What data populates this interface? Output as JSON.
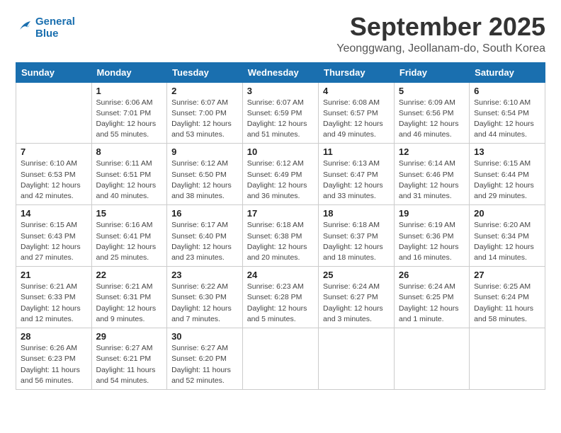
{
  "logo": {
    "line1": "General",
    "line2": "Blue"
  },
  "title": "September 2025",
  "subtitle": "Yeonggwang, Jeollanam-do, South Korea",
  "days_of_week": [
    "Sunday",
    "Monday",
    "Tuesday",
    "Wednesday",
    "Thursday",
    "Friday",
    "Saturday"
  ],
  "weeks": [
    [
      {
        "day": "",
        "detail": ""
      },
      {
        "day": "1",
        "detail": "Sunrise: 6:06 AM\nSunset: 7:01 PM\nDaylight: 12 hours\nand 55 minutes."
      },
      {
        "day": "2",
        "detail": "Sunrise: 6:07 AM\nSunset: 7:00 PM\nDaylight: 12 hours\nand 53 minutes."
      },
      {
        "day": "3",
        "detail": "Sunrise: 6:07 AM\nSunset: 6:59 PM\nDaylight: 12 hours\nand 51 minutes."
      },
      {
        "day": "4",
        "detail": "Sunrise: 6:08 AM\nSunset: 6:57 PM\nDaylight: 12 hours\nand 49 minutes."
      },
      {
        "day": "5",
        "detail": "Sunrise: 6:09 AM\nSunset: 6:56 PM\nDaylight: 12 hours\nand 46 minutes."
      },
      {
        "day": "6",
        "detail": "Sunrise: 6:10 AM\nSunset: 6:54 PM\nDaylight: 12 hours\nand 44 minutes."
      }
    ],
    [
      {
        "day": "7",
        "detail": "Sunrise: 6:10 AM\nSunset: 6:53 PM\nDaylight: 12 hours\nand 42 minutes."
      },
      {
        "day": "8",
        "detail": "Sunrise: 6:11 AM\nSunset: 6:51 PM\nDaylight: 12 hours\nand 40 minutes."
      },
      {
        "day": "9",
        "detail": "Sunrise: 6:12 AM\nSunset: 6:50 PM\nDaylight: 12 hours\nand 38 minutes."
      },
      {
        "day": "10",
        "detail": "Sunrise: 6:12 AM\nSunset: 6:49 PM\nDaylight: 12 hours\nand 36 minutes."
      },
      {
        "day": "11",
        "detail": "Sunrise: 6:13 AM\nSunset: 6:47 PM\nDaylight: 12 hours\nand 33 minutes."
      },
      {
        "day": "12",
        "detail": "Sunrise: 6:14 AM\nSunset: 6:46 PM\nDaylight: 12 hours\nand 31 minutes."
      },
      {
        "day": "13",
        "detail": "Sunrise: 6:15 AM\nSunset: 6:44 PM\nDaylight: 12 hours\nand 29 minutes."
      }
    ],
    [
      {
        "day": "14",
        "detail": "Sunrise: 6:15 AM\nSunset: 6:43 PM\nDaylight: 12 hours\nand 27 minutes."
      },
      {
        "day": "15",
        "detail": "Sunrise: 6:16 AM\nSunset: 6:41 PM\nDaylight: 12 hours\nand 25 minutes."
      },
      {
        "day": "16",
        "detail": "Sunrise: 6:17 AM\nSunset: 6:40 PM\nDaylight: 12 hours\nand 23 minutes."
      },
      {
        "day": "17",
        "detail": "Sunrise: 6:18 AM\nSunset: 6:38 PM\nDaylight: 12 hours\nand 20 minutes."
      },
      {
        "day": "18",
        "detail": "Sunrise: 6:18 AM\nSunset: 6:37 PM\nDaylight: 12 hours\nand 18 minutes."
      },
      {
        "day": "19",
        "detail": "Sunrise: 6:19 AM\nSunset: 6:36 PM\nDaylight: 12 hours\nand 16 minutes."
      },
      {
        "day": "20",
        "detail": "Sunrise: 6:20 AM\nSunset: 6:34 PM\nDaylight: 12 hours\nand 14 minutes."
      }
    ],
    [
      {
        "day": "21",
        "detail": "Sunrise: 6:21 AM\nSunset: 6:33 PM\nDaylight: 12 hours\nand 12 minutes."
      },
      {
        "day": "22",
        "detail": "Sunrise: 6:21 AM\nSunset: 6:31 PM\nDaylight: 12 hours\nand 9 minutes."
      },
      {
        "day": "23",
        "detail": "Sunrise: 6:22 AM\nSunset: 6:30 PM\nDaylight: 12 hours\nand 7 minutes."
      },
      {
        "day": "24",
        "detail": "Sunrise: 6:23 AM\nSunset: 6:28 PM\nDaylight: 12 hours\nand 5 minutes."
      },
      {
        "day": "25",
        "detail": "Sunrise: 6:24 AM\nSunset: 6:27 PM\nDaylight: 12 hours\nand 3 minutes."
      },
      {
        "day": "26",
        "detail": "Sunrise: 6:24 AM\nSunset: 6:25 PM\nDaylight: 12 hours\nand 1 minute."
      },
      {
        "day": "27",
        "detail": "Sunrise: 6:25 AM\nSunset: 6:24 PM\nDaylight: 11 hours\nand 58 minutes."
      }
    ],
    [
      {
        "day": "28",
        "detail": "Sunrise: 6:26 AM\nSunset: 6:23 PM\nDaylight: 11 hours\nand 56 minutes."
      },
      {
        "day": "29",
        "detail": "Sunrise: 6:27 AM\nSunset: 6:21 PM\nDaylight: 11 hours\nand 54 minutes."
      },
      {
        "day": "30",
        "detail": "Sunrise: 6:27 AM\nSunset: 6:20 PM\nDaylight: 11 hours\nand 52 minutes."
      },
      {
        "day": "",
        "detail": ""
      },
      {
        "day": "",
        "detail": ""
      },
      {
        "day": "",
        "detail": ""
      },
      {
        "day": "",
        "detail": ""
      }
    ]
  ]
}
